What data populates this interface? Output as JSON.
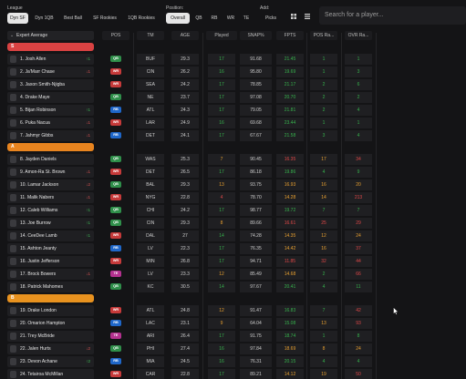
{
  "filters": {
    "league_label": "League",
    "position_label": "Position:",
    "add_label": "Add:",
    "league_tabs": [
      "Dyn SF",
      "Dyn 1QB",
      "Best Ball",
      "SF Rookies",
      "1QB Rookies"
    ],
    "position_tabs": [
      "Overall",
      "QB",
      "RB",
      "WR",
      "TE"
    ],
    "add_tabs": [
      "Picks"
    ]
  },
  "search": {
    "placeholder": "Search for a player..."
  },
  "sort": {
    "label": "Expert Average"
  },
  "columns": {
    "pos": "POS",
    "tm": "TM",
    "age": "AGE",
    "played": "Played",
    "snaps": "SNAP%",
    "fpts": "FPTS",
    "pos_rank": "POS Ra...",
    "ovr_rank": "OVR Ra..."
  },
  "colors": {
    "QB": "#2f8f4a",
    "RB": "#1f67c9",
    "WR": "#c63a3a",
    "TE": "#b4318f",
    "tier_S": "#d94242",
    "tier_A": "#e8841f",
    "tier_B": "#e8921f",
    "green": "#37b24d",
    "orange": "#e8a030",
    "red": "#e04848"
  },
  "tiers": [
    {
      "label": "S"
    },
    {
      "label": "A"
    },
    {
      "label": "B"
    }
  ],
  "players": [
    {
      "rank_name": "1. Josh Allen",
      "change": "1",
      "dir": "up",
      "pos": "QB",
      "tm": "BUF",
      "age": "29.3",
      "played": "17",
      "snaps": "91.68",
      "fpts": "21.45",
      "pos_rank": "1",
      "ovr_rank": "1",
      "c_played": "green",
      "c_fpts": "green",
      "c_pos": "green",
      "c_ovr": "green"
    },
    {
      "rank_name": "2. Ja'Marr Chase",
      "change": "1",
      "dir": "down",
      "pos": "WR",
      "tm": "CIN",
      "age": "26.2",
      "played": "16",
      "snaps": "95.80",
      "fpts": "19.69",
      "pos_rank": "1",
      "ovr_rank": "3",
      "c_played": "green",
      "c_fpts": "green",
      "c_pos": "green",
      "c_ovr": "green"
    },
    {
      "rank_name": "3. Jaxon Smith-Njigba",
      "change": "",
      "dir": "",
      "pos": "WR",
      "tm": "SEA",
      "age": "24.2",
      "played": "17",
      "snaps": "78.85",
      "fpts": "21.17",
      "pos_rank": "2",
      "ovr_rank": "6",
      "c_played": "green",
      "c_fpts": "green",
      "c_pos": "green",
      "c_ovr": "green"
    },
    {
      "rank_name": "4. Drake Maye",
      "change": "",
      "dir": "",
      "pos": "QB",
      "tm": "NE",
      "age": "23.7",
      "played": "17",
      "snaps": "97.08",
      "fpts": "20.70",
      "pos_rank": "2",
      "ovr_rank": "2",
      "c_played": "green",
      "c_fpts": "green",
      "c_pos": "green",
      "c_ovr": "green"
    },
    {
      "rank_name": "5. Bijan Robinson",
      "change": "1",
      "dir": "up",
      "pos": "RB",
      "tm": "ATL",
      "age": "24.3",
      "played": "17",
      "snaps": "79.05",
      "fpts": "21.81",
      "pos_rank": "2",
      "ovr_rank": "4",
      "c_played": "green",
      "c_fpts": "green",
      "c_pos": "green",
      "c_ovr": "green"
    },
    {
      "rank_name": "6. Puka Nacua",
      "change": "1",
      "dir": "down",
      "pos": "WR",
      "tm": "LAR",
      "age": "24.9",
      "played": "16",
      "snaps": "69.68",
      "fpts": "23.44",
      "pos_rank": "1",
      "ovr_rank": "1",
      "c_played": "green",
      "c_fpts": "green",
      "c_pos": "green",
      "c_ovr": "green"
    },
    {
      "rank_name": "7. Jahmyr Gibbs",
      "change": "1",
      "dir": "down",
      "pos": "RB",
      "tm": "DET",
      "age": "24.1",
      "played": "17",
      "snaps": "67.67",
      "fpts": "21.58",
      "pos_rank": "3",
      "ovr_rank": "4",
      "c_played": "green",
      "c_fpts": "green",
      "c_pos": "green",
      "c_ovr": "green"
    },
    {
      "rank_name": "8. Jayden Daniels",
      "change": "",
      "dir": "",
      "pos": "QB",
      "tm": "WAS",
      "age": "25.3",
      "played": "7",
      "snaps": "90.45",
      "fpts": "16.35",
      "pos_rank": "17",
      "ovr_rank": "34",
      "c_played": "orange",
      "c_fpts": "red",
      "c_pos": "orange",
      "c_ovr": "red"
    },
    {
      "rank_name": "9. Amon-Ra St. Brown",
      "change": "1",
      "dir": "down",
      "pos": "WR",
      "tm": "DET",
      "age": "26.5",
      "played": "17",
      "snaps": "86.18",
      "fpts": "19.86",
      "pos_rank": "4",
      "ovr_rank": "9",
      "c_played": "green",
      "c_fpts": "green",
      "c_pos": "green",
      "c_ovr": "green"
    },
    {
      "rank_name": "10. Lamar Jackson",
      "change": "2",
      "dir": "down",
      "pos": "QB",
      "tm": "BAL",
      "age": "29.3",
      "played": "13",
      "snaps": "93.75",
      "fpts": "16.93",
      "pos_rank": "16",
      "ovr_rank": "20",
      "c_played": "orange",
      "c_fpts": "orange",
      "c_pos": "orange",
      "c_ovr": "orange"
    },
    {
      "rank_name": "11. Malik Nabers",
      "change": "1",
      "dir": "down",
      "pos": "WR",
      "tm": "NYG",
      "age": "22.8",
      "played": "4",
      "snaps": "78.70",
      "fpts": "14.28",
      "pos_rank": "14",
      "ovr_rank": "213",
      "c_played": "red",
      "c_fpts": "orange",
      "c_pos": "orange",
      "c_ovr": "red"
    },
    {
      "rank_name": "12. Caleb Williams",
      "change": "1",
      "dir": "up",
      "pos": "QB",
      "tm": "CHI",
      "age": "24.2",
      "played": "17",
      "snaps": "98.77",
      "fpts": "19.72",
      "pos_rank": "7",
      "ovr_rank": "7",
      "c_played": "green",
      "c_fpts": "green",
      "c_pos": "green",
      "c_ovr": "green"
    },
    {
      "rank_name": "13. Joe Burrow",
      "change": "1",
      "dir": "up",
      "pos": "QB",
      "tm": "CIN",
      "age": "29.3",
      "played": "8",
      "snaps": "89.66",
      "fpts": "16.61",
      "pos_rank": "25",
      "ovr_rank": "29",
      "c_played": "orange",
      "c_fpts": "red",
      "c_pos": "red",
      "c_ovr": "red"
    },
    {
      "rank_name": "14. CeeDee Lamb",
      "change": "1",
      "dir": "up",
      "pos": "WR",
      "tm": "DAL",
      "age": "27",
      "played": "14",
      "snaps": "74.28",
      "fpts": "14.35",
      "pos_rank": "12",
      "ovr_rank": "24",
      "c_played": "green",
      "c_fpts": "orange",
      "c_pos": "orange",
      "c_ovr": "orange"
    },
    {
      "rank_name": "15. Ashton Jeanty",
      "change": "",
      "dir": "",
      "pos": "RB",
      "tm": "LV",
      "age": "22.3",
      "played": "17",
      "snaps": "76.35",
      "fpts": "14.42",
      "pos_rank": "16",
      "ovr_rank": "37",
      "c_played": "green",
      "c_fpts": "orange",
      "c_pos": "orange",
      "c_ovr": "red"
    },
    {
      "rank_name": "16. Justin Jefferson",
      "change": "",
      "dir": "",
      "pos": "WR",
      "tm": "MIN",
      "age": "26.8",
      "played": "17",
      "snaps": "94.71",
      "fpts": "11.85",
      "pos_rank": "32",
      "ovr_rank": "44",
      "c_played": "green",
      "c_fpts": "red",
      "c_pos": "red",
      "c_ovr": "red"
    },
    {
      "rank_name": "17. Brock Bowers",
      "change": "1",
      "dir": "down",
      "pos": "TE",
      "tm": "LV",
      "age": "23.3",
      "played": "12",
      "snaps": "85.49",
      "fpts": "14.68",
      "pos_rank": "2",
      "ovr_rank": "66",
      "c_played": "orange",
      "c_fpts": "orange",
      "c_pos": "green",
      "c_ovr": "red"
    },
    {
      "rank_name": "18. Patrick Mahomes",
      "change": "",
      "dir": "",
      "pos": "QB",
      "tm": "KC",
      "age": "30.5",
      "played": "14",
      "snaps": "97.67",
      "fpts": "20.41",
      "pos_rank": "4",
      "ovr_rank": "11",
      "c_played": "green",
      "c_fpts": "green",
      "c_pos": "green",
      "c_ovr": "green"
    },
    {
      "rank_name": "19. Drake London",
      "change": "",
      "dir": "",
      "pos": "WR",
      "tm": "ATL",
      "age": "24.8",
      "played": "12",
      "snaps": "91.47",
      "fpts": "16.83",
      "pos_rank": "7",
      "ovr_rank": "42",
      "c_played": "orange",
      "c_fpts": "green",
      "c_pos": "green",
      "c_ovr": "red"
    },
    {
      "rank_name": "20. Omarion Hampton",
      "change": "",
      "dir": "",
      "pos": "RB",
      "tm": "LAC",
      "age": "23.1",
      "played": "9",
      "snaps": "64.04",
      "fpts": "15.08",
      "pos_rank": "13",
      "ovr_rank": "93",
      "c_played": "orange",
      "c_fpts": "green",
      "c_pos": "orange",
      "c_ovr": "red"
    },
    {
      "rank_name": "21. Trey McBride",
      "change": "",
      "dir": "",
      "pos": "TE",
      "tm": "ARI",
      "age": "26.4",
      "played": "17",
      "snaps": "91.75",
      "fpts": "18.74",
      "pos_rank": "1",
      "ovr_rank": "8",
      "c_played": "green",
      "c_fpts": "green",
      "c_pos": "green",
      "c_ovr": "green"
    },
    {
      "rank_name": "22. Jalen Hurts",
      "change": "2",
      "dir": "down",
      "pos": "QB",
      "tm": "PHI",
      "age": "27.4",
      "played": "16",
      "snaps": "97.84",
      "fpts": "18.69",
      "pos_rank": "8",
      "ovr_rank": "24",
      "c_played": "green",
      "c_fpts": "orange",
      "c_pos": "orange",
      "c_ovr": "orange"
    },
    {
      "rank_name": "23. Devon Achane",
      "change": "2",
      "dir": "up",
      "pos": "RB",
      "tm": "MIA",
      "age": "24.5",
      "played": "16",
      "snaps": "76.31",
      "fpts": "20.15",
      "pos_rank": "4",
      "ovr_rank": "4",
      "c_played": "green",
      "c_fpts": "green",
      "c_pos": "green",
      "c_ovr": "green"
    },
    {
      "rank_name": "24. Tetairoa McMillan",
      "change": "",
      "dir": "",
      "pos": "WR",
      "tm": "CAR",
      "age": "22.8",
      "played": "17",
      "snaps": "89.21",
      "fpts": "14.12",
      "pos_rank": "19",
      "ovr_rank": "50",
      "c_played": "green",
      "c_fpts": "orange",
      "c_pos": "orange",
      "c_ovr": "red"
    }
  ]
}
